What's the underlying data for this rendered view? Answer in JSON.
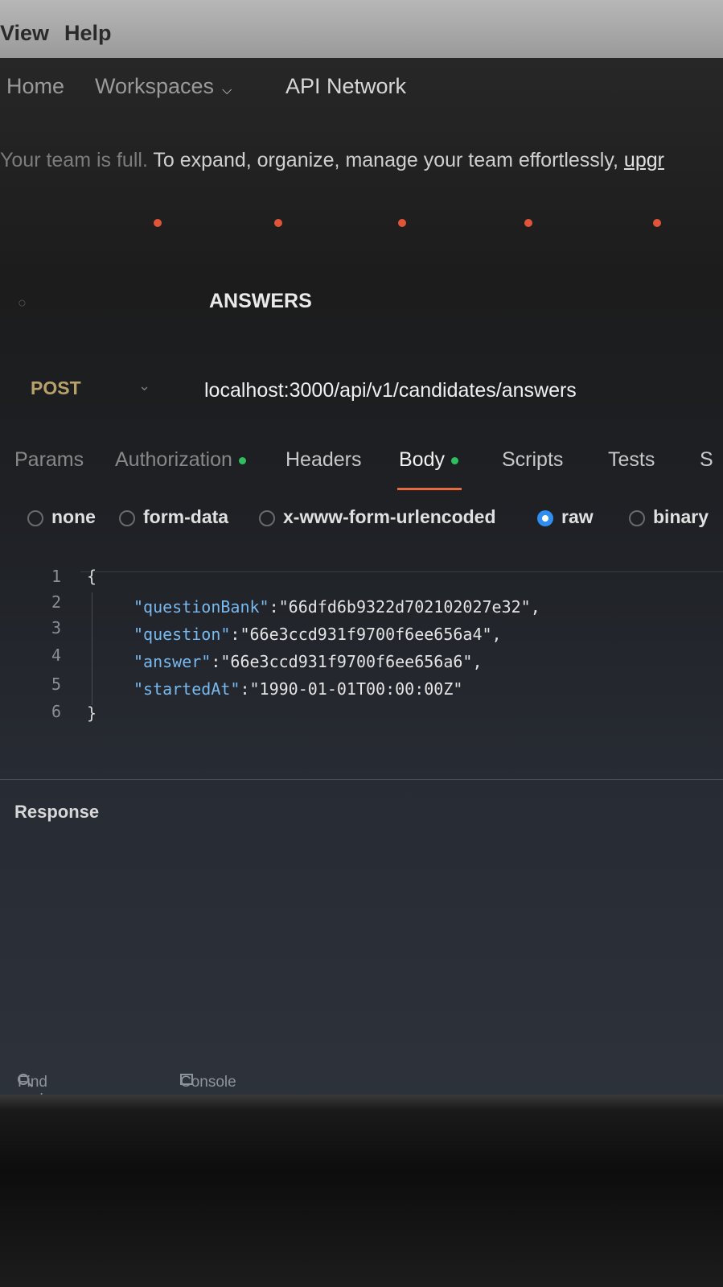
{
  "menu": {
    "items": [
      "View",
      "Help"
    ]
  },
  "nav": {
    "home": "Home",
    "workspaces": "Workspaces",
    "api_network": "API Network"
  },
  "banner": {
    "faint_text": "Your team is full.",
    "text": "To expand, organize, manage your team effortlessly,",
    "link": "upgr"
  },
  "request": {
    "name": "ANSWERS",
    "method": "POST",
    "url": "localhost:3000/api/v1/candidates/answers"
  },
  "tabs": [
    "Params",
    "Authorization",
    "Headers",
    "Body",
    "Scripts",
    "Tests",
    "S"
  ],
  "body_options": [
    "none",
    "form-data",
    "x-www-form-urlencoded",
    "raw",
    "binary"
  ],
  "selected_body_option": "raw",
  "editor": {
    "line_numbers": [
      "1",
      "2",
      "3",
      "4",
      "5",
      "6"
    ],
    "open_brace": "{",
    "close_brace": "}",
    "lines": [
      {
        "key": "\"questionBank\"",
        "sep": ":",
        "value": "\"66dfd6b9322d702102027e32\",",
        "trail": ""
      },
      {
        "key": "\"question\"",
        "sep": ":",
        "value": "\"66e3ccd931f9700f6ee656a4\",",
        "trail": ""
      },
      {
        "key": "\"answer\"",
        "sep": ":",
        "value": "\"66e3ccd931f9700f6ee656a6\",",
        "trail": ""
      },
      {
        "key": "\"startedAt\"",
        "sep": ":",
        "value": "\"1990-01-01T00:00:00Z\"",
        "trail": ""
      }
    ]
  },
  "response": {
    "label": "Response"
  },
  "statusbar": {
    "find": "Find and replace",
    "console": "Console"
  },
  "colors": {
    "accent_underline": "#e56a3d",
    "dot_green": "#2fbf5f",
    "radio_selected": "#2f8ef0",
    "json_key": "#78b9ef",
    "tab_dot": "#e0553a"
  }
}
